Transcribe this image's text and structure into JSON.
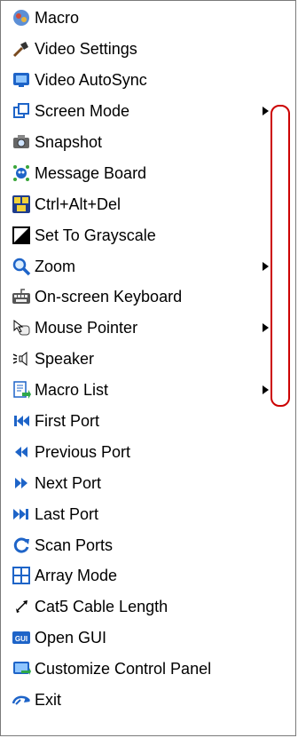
{
  "menu": {
    "items": [
      {
        "label": "Macro",
        "icon": "macro-icon",
        "submenu": false
      },
      {
        "label": "Video Settings",
        "icon": "video-settings-icon",
        "submenu": false
      },
      {
        "label": "Video AutoSync",
        "icon": "autosync-icon",
        "submenu": false
      },
      {
        "label": "Screen Mode",
        "icon": "screen-mode-icon",
        "submenu": true
      },
      {
        "label": "Snapshot",
        "icon": "camera-icon",
        "submenu": false
      },
      {
        "label": "Message Board",
        "icon": "message-board-icon",
        "submenu": false
      },
      {
        "label": "Ctrl+Alt+Del",
        "icon": "ctrl-alt-del-icon",
        "submenu": false
      },
      {
        "label": "Set To Grayscale",
        "icon": "grayscale-icon",
        "submenu": false
      },
      {
        "label": "Zoom",
        "icon": "zoom-icon",
        "submenu": true
      },
      {
        "label": "On-screen Keyboard",
        "icon": "keyboard-icon",
        "submenu": false
      },
      {
        "label": "Mouse Pointer",
        "icon": "mouse-pointer-icon",
        "submenu": true
      },
      {
        "label": "Speaker",
        "icon": "speaker-icon",
        "submenu": false
      },
      {
        "label": "Macro List",
        "icon": "macro-list-icon",
        "submenu": true
      },
      {
        "label": "First Port",
        "icon": "first-port-icon",
        "submenu": false
      },
      {
        "label": "Previous Port",
        "icon": "previous-port-icon",
        "submenu": false
      },
      {
        "label": "Next Port",
        "icon": "next-port-icon",
        "submenu": false
      },
      {
        "label": "Last Port",
        "icon": "last-port-icon",
        "submenu": false
      },
      {
        "label": "Scan Ports",
        "icon": "scan-ports-icon",
        "submenu": false
      },
      {
        "label": "Array Mode",
        "icon": "array-mode-icon",
        "submenu": false
      },
      {
        "label": "Cat5 Cable Length",
        "icon": "cable-length-icon",
        "submenu": false
      },
      {
        "label": "Open GUI",
        "icon": "gui-icon",
        "submenu": false
      },
      {
        "label": "Customize Control Panel",
        "icon": "customize-panel-icon",
        "submenu": false
      },
      {
        "label": "Exit",
        "icon": "exit-icon",
        "submenu": false
      }
    ]
  },
  "colors": {
    "highlight_border": "#cc0000",
    "accent_blue": "#1e64c8"
  }
}
